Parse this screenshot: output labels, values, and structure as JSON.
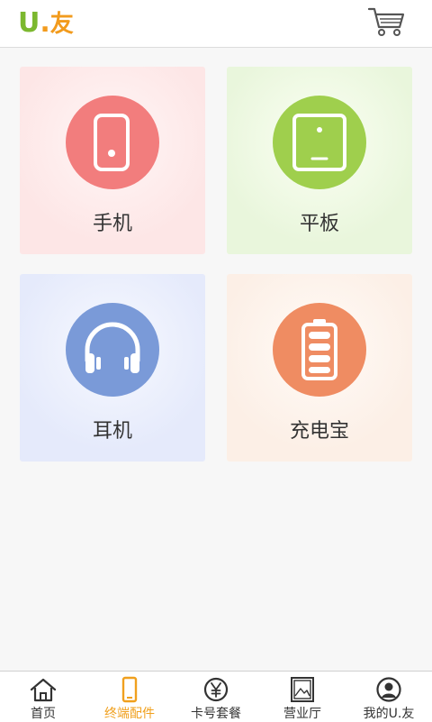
{
  "header": {
    "logo_u": "U",
    "logo_dot": ".",
    "logo_you": "友"
  },
  "colors": {
    "logo_green": "#7cb82f",
    "logo_orange": "#f29b1d",
    "phone_circle": "#f27d7d",
    "tablet_circle": "#9fcf4d",
    "headphone_circle": "#7a9ad8",
    "battery_circle": "#ef8c62",
    "active_tab": "#f0a01e"
  },
  "categories": [
    {
      "label": "手机",
      "icon": "phone-icon"
    },
    {
      "label": "平板",
      "icon": "tablet-icon"
    },
    {
      "label": "耳机",
      "icon": "headphone-icon"
    },
    {
      "label": "充电宝",
      "icon": "battery-icon"
    }
  ],
  "tabbar": {
    "items": [
      {
        "label": "首页",
        "icon": "home-icon",
        "active": false
      },
      {
        "label": "终端配件",
        "icon": "phone-icon",
        "active": true
      },
      {
        "label": "卡号套餐",
        "icon": "yuan-icon",
        "active": false
      },
      {
        "label": "营业厅",
        "icon": "picture-icon",
        "active": false
      },
      {
        "label": "我的U.友",
        "icon": "user-icon",
        "active": false
      }
    ]
  }
}
